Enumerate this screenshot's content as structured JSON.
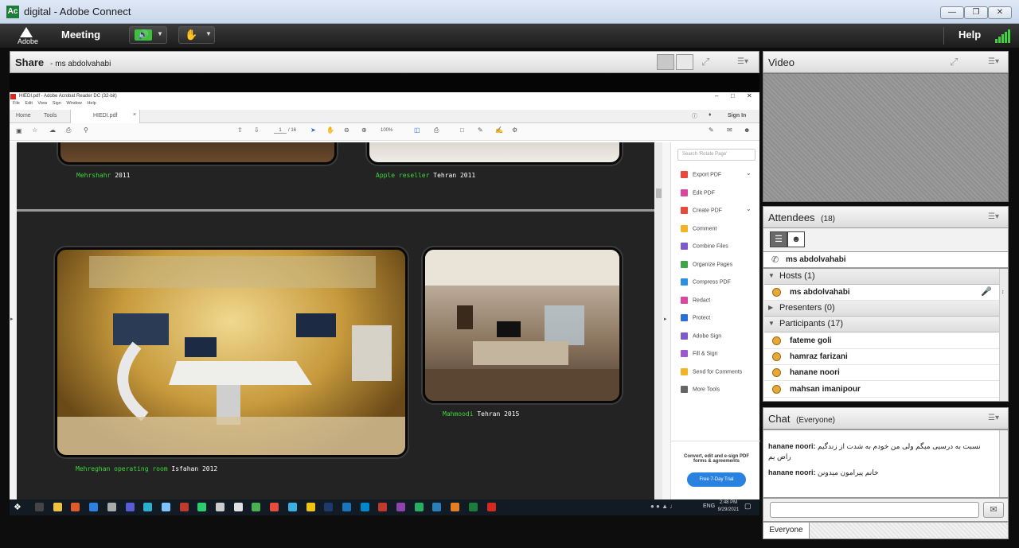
{
  "window": {
    "title": "digital - Adobe Connect",
    "app_icon": "Ac"
  },
  "menubar": {
    "logo_text": "Adobe",
    "meeting_label": "Meeting",
    "help_label": "Help"
  },
  "share_pod": {
    "title": "Share",
    "presenter": "ms abdolvahabi"
  },
  "pdf": {
    "title": "HIEDI.pdf - Adobe Acrobat Reader DC (32-bit)",
    "menu": [
      "File",
      "Edit",
      "View",
      "Sign",
      "Window",
      "Help"
    ],
    "tabs": {
      "home": "Home",
      "tools": "Tools",
      "doc": "HIEDI.pdf"
    },
    "sign_in": "Sign In",
    "page": "1",
    "page_total": "/ 16",
    "zoom": "100%",
    "captions": [
      {
        "green": "Mehrshahr",
        "white": "2011"
      },
      {
        "green": "Apple reseller",
        "white": "Tehran 2011"
      },
      {
        "green": "Mahmoodi",
        "white": "Tehran 2015"
      },
      {
        "green": "Mehreghan operating room",
        "white": "Isfahan 2012"
      }
    ],
    "search_placeholder": "Search 'Rotate Page'",
    "tools": [
      {
        "label": "Export PDF",
        "color": "#e64a3c"
      },
      {
        "label": "Edit PDF",
        "color": "#d9489e"
      },
      {
        "label": "Create PDF",
        "color": "#e64a3c"
      },
      {
        "label": "Comment",
        "color": "#f2b425"
      },
      {
        "label": "Combine Files",
        "color": "#7a5bc9"
      },
      {
        "label": "Organize Pages",
        "color": "#3fa34a"
      },
      {
        "label": "Compress PDF",
        "color": "#2d8fe0"
      },
      {
        "label": "Redact",
        "color": "#d9489e"
      },
      {
        "label": "Protect",
        "color": "#2d6fd6"
      },
      {
        "label": "Adobe Sign",
        "color": "#7a5bc9"
      },
      {
        "label": "Fill & Sign",
        "color": "#9b59d0"
      },
      {
        "label": "Send for Comments",
        "color": "#f2b425"
      },
      {
        "label": "More Tools",
        "color": "#666666"
      }
    ],
    "promo_text": "Convert, edit and e-sign PDF forms & agreements",
    "trial_button": "Free 7-Day Trial"
  },
  "taskbar": {
    "lang": "ENG",
    "time": "2:48 PM",
    "date": "9/29/2021"
  },
  "video_pod": {
    "title": "Video"
  },
  "attendees_pod": {
    "title": "Attendees",
    "count": "(18)",
    "current_user": "ms abdolvahabi",
    "hosts_label": "Hosts (1)",
    "hosts": [
      "ms abdolvahabi"
    ],
    "presenters_label": "Presenters (0)",
    "participants_label": "Participants (17)",
    "participants": [
      "fateme goli",
      "hamraz farizani",
      "hanane noori",
      "mahsan imanipour"
    ]
  },
  "chat_pod": {
    "title": "Chat",
    "scope": "(Everyone)",
    "messages": [
      {
        "sender": "hanane noori:",
        "text": "نسبت به درسیی میگم ولی من خودم به شدت از زندگیم راض یم"
      },
      {
        "sender": "hanane noori:",
        "text": "خانم پیرامون میدونن"
      }
    ],
    "recipient_tab": "Everyone"
  }
}
